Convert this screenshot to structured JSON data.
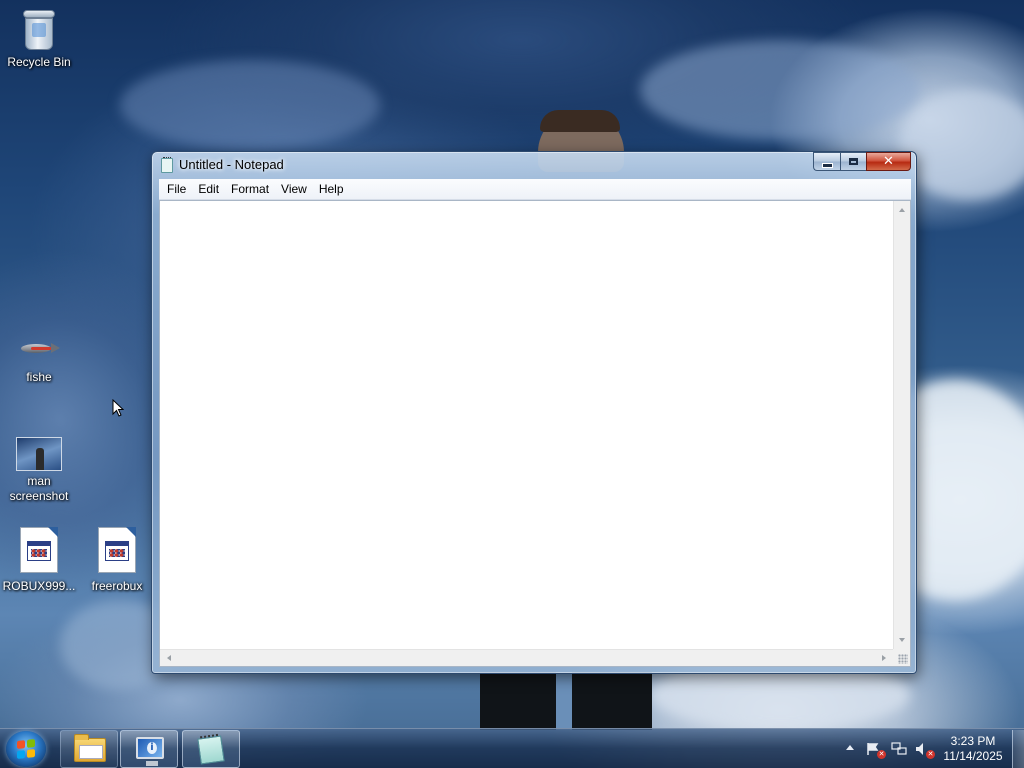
{
  "desktop": {
    "icons": [
      {
        "label": "Recycle Bin",
        "icon": "recycle-bin-icon"
      },
      {
        "label": "fishe",
        "icon": "fish-image-icon"
      },
      {
        "label": "man\nscreenshot",
        "label_line1": "man",
        "label_line2": "screenshot",
        "icon": "image-file-icon"
      },
      {
        "label": "ROBUX999...",
        "icon": "application-file-icon"
      },
      {
        "label": "freerobux",
        "icon": "application-file-icon"
      }
    ]
  },
  "window": {
    "title": "Untitled - Notepad",
    "icon": "notepad-icon",
    "menu": [
      "File",
      "Edit",
      "Format",
      "View",
      "Help"
    ],
    "content": "",
    "buttons": {
      "minimize": "minimize-icon",
      "maximize": "maximize-icon",
      "close": "✕"
    }
  },
  "taskbar": {
    "start": "windows-start-orb",
    "items": [
      {
        "name": "Windows Explorer",
        "icon": "folder-icon",
        "state": "pinned"
      },
      {
        "name": "Remote Desktop",
        "icon": "monitor-icon",
        "state": "running"
      },
      {
        "name": "Notepad",
        "icon": "notepad-icon",
        "state": "active"
      }
    ],
    "tray": {
      "icons": [
        "show-hidden-icons-arrow",
        "action-center-flag-icon",
        "network-icon",
        "volume-muted-icon"
      ],
      "time": "3:23 PM",
      "date": "11/14/2025"
    }
  },
  "colors": {
    "window_glass": "#96b6d8",
    "close_button": "#c73a1f",
    "taskbar": "#1c3456"
  }
}
